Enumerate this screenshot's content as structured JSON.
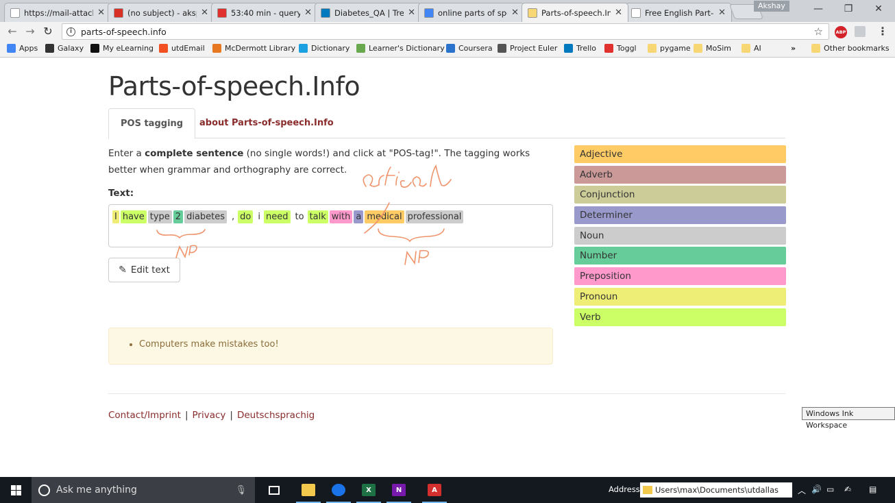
{
  "browser": {
    "tabs": [
      {
        "title": "https://mail-attach",
        "favicon_color": "#ffffff"
      },
      {
        "title": "(no subject) - aksp",
        "favicon_color": "#d93025"
      },
      {
        "title": "53:40 min - query",
        "favicon_color": "#e0312e"
      },
      {
        "title": "Diabetes_QA | Trel",
        "favicon_color": "#0079bf"
      },
      {
        "title": "online parts of spe",
        "favicon_color": "#4285f4"
      },
      {
        "title": "Parts-of-speech.In",
        "favicon_color": "#f7d774"
      },
      {
        "title": "Free English Part-o",
        "favicon_color": "#ffffff"
      }
    ],
    "active_tab": 5,
    "profile": "Akshay",
    "url": "parts-of-speech.info",
    "bookmarks": [
      {
        "label": "Apps",
        "icon_color": "#4285f4"
      },
      {
        "label": "Galaxy",
        "icon_color": "#333333"
      },
      {
        "label": "My eLearning",
        "icon_color": "#111111"
      },
      {
        "label": "utdEmail",
        "icon_color": "#f25022"
      },
      {
        "label": "McDermott Library",
        "icon_color": "#e87722"
      },
      {
        "label": "Dictionary",
        "icon_color": "#1ba1e2"
      },
      {
        "label": "Learner's Dictionary",
        "icon_color": "#6aa84f"
      },
      {
        "label": "Coursera",
        "icon_color": "#2a73cc"
      },
      {
        "label": "Project Euler",
        "icon_color": "#555555"
      },
      {
        "label": "Trello",
        "icon_color": "#0079bf"
      },
      {
        "label": "Toggl",
        "icon_color": "#e0312e"
      },
      {
        "label": "pygame",
        "icon_color": "#f7d774"
      },
      {
        "label": "MoSim",
        "icon_color": "#f7d774"
      },
      {
        "label": "AI",
        "icon_color": "#f7d774"
      }
    ],
    "overflow": "»",
    "other_bookmarks": "Other bookmarks"
  },
  "page": {
    "title": "Parts-of-speech.Info",
    "nav": {
      "tab_active": "POS tagging",
      "tab_about": "about Parts-of-speech.Info"
    },
    "intro_1": "Enter a ",
    "intro_bold": "complete sentence",
    "intro_2": " (no single words!) and click at \"POS-tag!\". The tagging works better when grammar and orthography are correct.",
    "text_label": "Text:",
    "tokens": [
      {
        "w": "I",
        "pos": "Pronoun"
      },
      {
        "w": "have",
        "pos": "Verb"
      },
      {
        "w": "type",
        "pos": "Noun"
      },
      {
        "w": "2",
        "pos": "Number"
      },
      {
        "w": "diabetes",
        "pos": "Noun"
      },
      {
        "w": ",",
        "pos": ""
      },
      {
        "w": "do",
        "pos": "Verb"
      },
      {
        "w": "i",
        "pos": ""
      },
      {
        "w": "need",
        "pos": "Verb"
      },
      {
        "w": "to",
        "pos": ""
      },
      {
        "w": "talk",
        "pos": "Verb"
      },
      {
        "w": "with",
        "pos": "Preposition"
      },
      {
        "w": "a",
        "pos": "Determiner"
      },
      {
        "w": "medical",
        "pos": "Adjective"
      },
      {
        "w": "professional",
        "pos": "Noun"
      }
    ],
    "edit_button": "Edit text",
    "warning": "Computers make mistakes too!",
    "footer": {
      "contact": "Contact/Imprint",
      "privacy": "Privacy",
      "german": "Deutschsprachig",
      "separator": "|"
    },
    "legend": [
      {
        "label": "Adjective",
        "color": "#fecb65"
      },
      {
        "label": "Adverb",
        "color": "#cc9999"
      },
      {
        "label": "Conjunction",
        "color": "#cccc99"
      },
      {
        "label": "Determiner",
        "color": "#9999cc"
      },
      {
        "label": "Noun",
        "color": "#cccccc"
      },
      {
        "label": "Number",
        "color": "#66cc99"
      },
      {
        "label": "Preposition",
        "color": "#ff99cc"
      },
      {
        "label": "Pronoun",
        "color": "#eeee77"
      },
      {
        "label": "Verb",
        "color": "#ccff66"
      }
    ],
    "ink_annotations": [
      "artical",
      "NP",
      "NP"
    ]
  },
  "ink_tooltip": "Windows Ink Workspace",
  "taskbar": {
    "search_placeholder": "Ask me anything",
    "address_label": "Address",
    "address_path": "Users\\max\\Documents\\utdallas",
    "apps": [
      {
        "name": "file-explorer",
        "color": "#f2c94c",
        "glyph": "",
        "running": true
      },
      {
        "name": "chrome",
        "color": "#1a73e8",
        "glyph": "",
        "running": true
      },
      {
        "name": "excel",
        "color": "#1e7145",
        "glyph": "X",
        "running": true
      },
      {
        "name": "onenote",
        "color": "#7719aa",
        "glyph": "N",
        "running": true
      },
      {
        "name": "acrobat",
        "color": "#d32f2f",
        "glyph": "A",
        "running": true
      }
    ]
  }
}
